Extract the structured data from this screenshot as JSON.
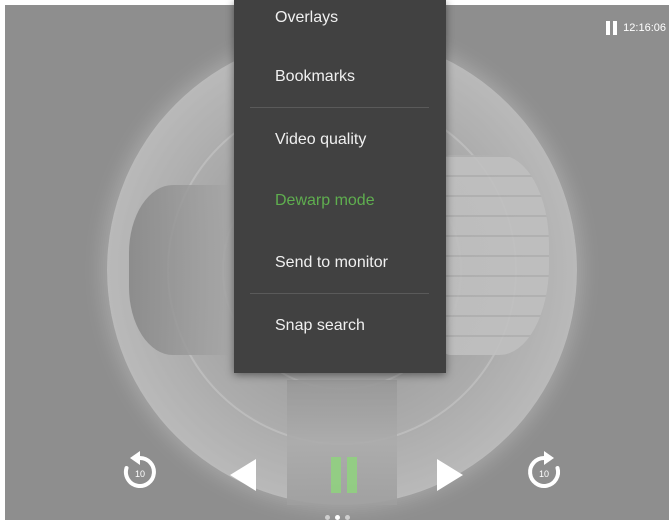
{
  "status": {
    "time": "12:16:06",
    "pause_icon": "pause-icon"
  },
  "menu": {
    "items": [
      {
        "label": "Overlays"
      },
      {
        "label": "Bookmarks"
      },
      {
        "label": "Video quality"
      },
      {
        "label": "Dewarp mode",
        "active": true
      },
      {
        "label": "Send to monitor"
      },
      {
        "label": "Snap search"
      }
    ],
    "active_color": "#5fae4f",
    "background": "#414141"
  },
  "controls": {
    "replay_seconds": "10",
    "forward_seconds": "10",
    "icons": [
      "replay-10-icon",
      "previous-icon",
      "play-indicator-icon",
      "next-icon",
      "forward-10-icon"
    ]
  },
  "pager": {
    "count": 3,
    "active_index": 1
  }
}
